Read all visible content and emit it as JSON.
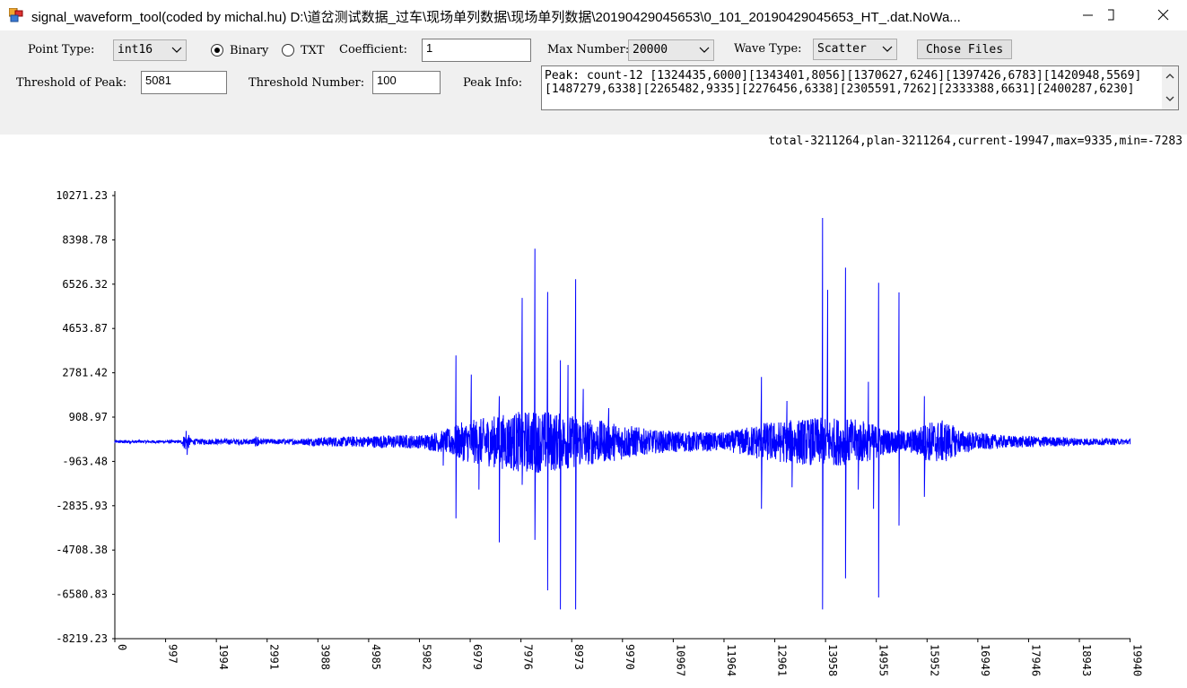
{
  "window": {
    "title": "signal_waveform_tool(coded by michal.hu) D:\\道岔测试数据_过车\\现场单列数据\\现场单列数据\\20190429045653\\0_101_20190429045653_HT_.dat.NoWa..."
  },
  "toolbar": {
    "point_type_label": "Point Type:",
    "point_type_value": "int16",
    "binary_label": "Binary",
    "txt_label": "TXT",
    "format_selected": "Binary",
    "coefficient_label": "Coefficient:",
    "coefficient_value": "1",
    "max_number_label": "Max Number:",
    "max_number_value": "20000",
    "wave_type_label": "Wave Type:",
    "wave_type_value": "Scatter",
    "chose_files_label": "Chose Files",
    "threshold_peak_label": "Threshold of Peak:",
    "threshold_peak_value": "5081",
    "threshold_number_label": "Threshold Number:",
    "threshold_number_value": "100",
    "peak_info_label": "Peak Info:",
    "peak_info_line1": "Peak: count-12 [1324435,6000][1343401,8056][1370627,6246][1397426,6783][1420948,5569]",
    "peak_info_line2": "[1487279,6338][2265482,9335][2276456,6338][2305591,7262][2333388,6631][2400287,6230]"
  },
  "stats_text": "total-3211264,plan-3211264,current-19947,max=9335,min=-7283",
  "colors": {
    "series": "#0000ff",
    "toolbar_bg": "#f0f0f0"
  },
  "chart_data": {
    "type": "line",
    "title": "",
    "xlabel": "",
    "ylabel": "",
    "xlim": [
      0,
      19947
    ],
    "ylim": [
      -8219.23,
      10271.23
    ],
    "y_ticks": [
      "10271.23",
      "8398.78",
      "6526.32",
      "4653.87",
      "2781.42",
      "908.97",
      "-963.48",
      "-2835.93",
      "-4708.38",
      "-6580.83",
      "-8219.23"
    ],
    "x_ticks": [
      "0",
      "997",
      "1994",
      "2991",
      "3988",
      "4985",
      "5982",
      "6979",
      "7976",
      "8973",
      "9970",
      "10967",
      "11964",
      "12961",
      "13958",
      "14955",
      "15952",
      "16949",
      "17946",
      "18943",
      "19940"
    ],
    "series": [
      {
        "baseline": 0,
        "envelope": [
          [
            0,
            60
          ],
          [
            1300,
            60
          ],
          [
            1400,
            450
          ],
          [
            1500,
            120
          ],
          [
            2700,
            120
          ],
          [
            2800,
            260
          ],
          [
            2900,
            110
          ],
          [
            3600,
            120
          ],
          [
            4100,
            200
          ],
          [
            4800,
            220
          ],
          [
            5300,
            280
          ],
          [
            6000,
            280
          ],
          [
            6500,
            500
          ],
          [
            6800,
            800
          ],
          [
            7000,
            900
          ],
          [
            7500,
            1100
          ],
          [
            8000,
            1300
          ],
          [
            8500,
            1300
          ],
          [
            9000,
            1100
          ],
          [
            9500,
            900
          ],
          [
            10000,
            750
          ],
          [
            10500,
            500
          ],
          [
            11000,
            450
          ],
          [
            11500,
            420
          ],
          [
            12000,
            380
          ],
          [
            12300,
            550
          ],
          [
            12700,
            800
          ],
          [
            13200,
            900
          ],
          [
            13700,
            1000
          ],
          [
            14200,
            1000
          ],
          [
            14700,
            900
          ],
          [
            15200,
            500
          ],
          [
            15600,
            450
          ],
          [
            16000,
            850
          ],
          [
            16300,
            900
          ],
          [
            16600,
            500
          ],
          [
            17000,
            360
          ],
          [
            17500,
            260
          ],
          [
            18000,
            240
          ],
          [
            18500,
            200
          ],
          [
            19000,
            160
          ],
          [
            19940,
            120
          ]
        ],
        "spikes": [
          [
            1400,
            450
          ],
          [
            1420,
            -550
          ],
          [
            6450,
            -1000
          ],
          [
            6700,
            3600
          ],
          [
            6700,
            -3200
          ],
          [
            7000,
            2800
          ],
          [
            7150,
            -2000
          ],
          [
            7550,
            1900
          ],
          [
            7550,
            -4200
          ],
          [
            8000,
            6000
          ],
          [
            8000,
            -1800
          ],
          [
            8250,
            8056
          ],
          [
            8250,
            -4100
          ],
          [
            8500,
            6246
          ],
          [
            8500,
            -6200
          ],
          [
            8750,
            3400
          ],
          [
            8750,
            -7000
          ],
          [
            8900,
            3200
          ],
          [
            9050,
            6783
          ],
          [
            9050,
            -7000
          ],
          [
            9200,
            2200
          ],
          [
            9700,
            1400
          ],
          [
            12700,
            2700
          ],
          [
            12700,
            -2800
          ],
          [
            13200,
            1700
          ],
          [
            13300,
            -1900
          ],
          [
            13900,
            9335
          ],
          [
            13900,
            -7000
          ],
          [
            14000,
            6338
          ],
          [
            14350,
            7262
          ],
          [
            14350,
            -5700
          ],
          [
            14600,
            -2000
          ],
          [
            14800,
            2500
          ],
          [
            14900,
            -2800
          ],
          [
            15000,
            6631
          ],
          [
            15000,
            -6500
          ],
          [
            15400,
            6230
          ],
          [
            15400,
            -3500
          ],
          [
            15900,
            1900
          ],
          [
            15900,
            -2300
          ]
        ]
      }
    ]
  }
}
